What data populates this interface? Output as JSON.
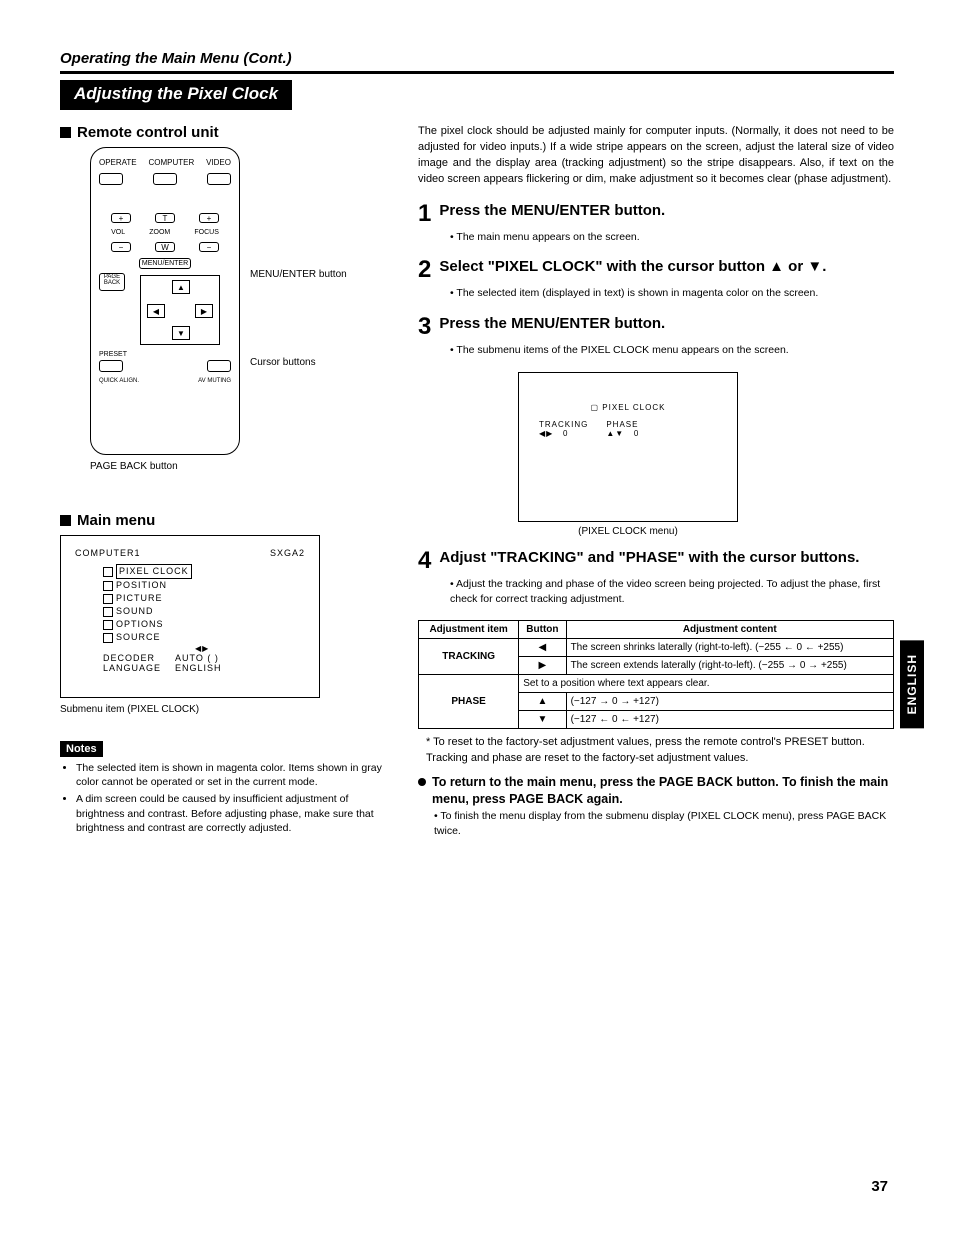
{
  "page_title": "Operating the Main Menu (Cont.)",
  "banner": "Adjusting the Pixel Clock",
  "side_tab": "ENGLISH",
  "page_number": "37",
  "left": {
    "remote_heading": "Remote control unit",
    "labels": {
      "menu_enter": "MENU/ENTER button",
      "cursor": "Cursor buttons",
      "page_back": "PAGE BACK button",
      "operate": "OPERATE",
      "computer": "COMPUTER",
      "video": "VIDEO",
      "vol": "VOL",
      "zoom": "ZOOM",
      "focus": "FOCUS",
      "page_back_btn": "PAGE BACK",
      "menu_enter_btn": "MENU/ENTER",
      "preset": "PRESET",
      "quick_align": "QUICK ALIGN.",
      "av_muting": "AV MUTING"
    },
    "main_menu_heading": "Main menu",
    "menu": {
      "header_left": "COMPUTER1",
      "header_right": "SXGA2",
      "items": [
        "PIXEL CLOCK",
        "POSITION",
        "PICTURE",
        "SOUND",
        "OPTIONS",
        "SOURCE"
      ],
      "decoder_label": "DECODER",
      "decoder_val": "AUTO (      )",
      "language_label": "LANGUAGE",
      "language_val": "ENGLISH",
      "arrows": "◀▶"
    },
    "menu_caption": "Submenu item (PIXEL CLOCK)",
    "notes_label": "Notes",
    "notes": [
      "The selected item is shown in magenta color. Items shown in gray color cannot be operated or set in the current mode.",
      "A dim screen could be caused by insufficient adjustment of brightness and contrast. Before adjusting phase, make sure that brightness and contrast are correctly adjusted."
    ]
  },
  "right": {
    "intro": "The pixel clock should be adjusted mainly for computer inputs. (Normally, it does not need to be adjusted for video inputs.) If a wide stripe appears on the screen, adjust the lateral size of video image and the display area (tracking adjustment) so the stripe disappears. Also, if text on the video screen appears flickering or dim, make adjustment so it becomes clear (phase adjustment).",
    "steps": {
      "s1": {
        "title": "Press the MENU/ENTER button.",
        "sub": "The main menu appears on the screen."
      },
      "s2": {
        "title": "Select \"PIXEL CLOCK\" with the cursor button ▲ or ▼.",
        "sub": "The selected item (displayed in text) is shown in magenta color on the screen."
      },
      "s3": {
        "title": "Press the MENU/ENTER button.",
        "sub": "The submenu items of the PIXEL CLOCK menu appears on the screen."
      },
      "s4": {
        "title": "Adjust \"TRACKING\" and \"PHASE\" with the cursor buttons.",
        "sub": "Adjust the tracking and phase of the video screen being projected. To adjust the phase, first check for correct tracking adjustment."
      }
    },
    "submenu": {
      "title": "PIXEL CLOCK",
      "tracking_label": "TRACKING",
      "tracking_arrows": "◀▶",
      "tracking_val": "0",
      "phase_label": "PHASE",
      "phase_arrows": "▲▼",
      "phase_val": "0",
      "caption": "(PIXEL CLOCK menu)"
    },
    "table_headers": {
      "item": "Adjustment item",
      "button": "Button",
      "content": "Adjustment content"
    },
    "table": {
      "tracking_label": "TRACKING",
      "tracking_left_content": "The screen shrinks laterally (right-to-left). (−255 ← 0 ← +255)",
      "tracking_right_content": "The screen extends laterally (right-to-left). (−255 → 0 → +255)",
      "phase_label": "PHASE",
      "phase_top_content": "Set to a position where text appears clear.",
      "phase_up_content": "(−127 → 0 → +127)",
      "phase_down_content": "(−127 ← 0 ← +127)"
    },
    "footnote": "* To reset to the factory-set adjustment values, press the remote control's PRESET button.\nTracking and phase are reset to the factory-set adjustment values.",
    "return": {
      "title": "To return to the main menu, press the PAGE BACK button. To finish the main menu, press PAGE BACK again.",
      "sub": "To finish the menu display from the submenu display (PIXEL CLOCK menu), press PAGE BACK twice."
    }
  }
}
